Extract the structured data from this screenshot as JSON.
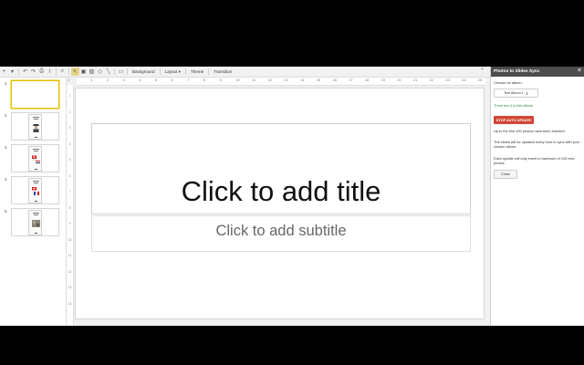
{
  "toolbar": {
    "buttons": [
      {
        "name": "new-slide-icon",
        "glyph": "+"
      },
      {
        "name": "dropdown-icon",
        "glyph": "▾"
      },
      {
        "name": "undo-icon",
        "glyph": "↶"
      },
      {
        "name": "redo-icon",
        "glyph": "↷"
      },
      {
        "name": "print-icon",
        "glyph": "⎙"
      },
      {
        "name": "paint-format-icon",
        "glyph": "⌇"
      },
      {
        "name": "zoom-icon",
        "glyph": "⌕"
      },
      {
        "name": "select-icon",
        "glyph": "↖"
      },
      {
        "name": "textbox-icon",
        "glyph": "▣"
      },
      {
        "name": "image-icon",
        "glyph": "▨"
      },
      {
        "name": "shape-icon",
        "glyph": "◇"
      },
      {
        "name": "line-icon",
        "glyph": "╲"
      },
      {
        "name": "comment-icon",
        "glyph": "▭"
      }
    ],
    "background_label": "Background",
    "layout_label": "Layout ▾",
    "theme_label": "Theme",
    "transition_label": "Transition",
    "collapse_glyph": "⌃"
  },
  "ruler": {
    "top_numbers": [
      "1",
      "1",
      "2",
      "3",
      "4",
      "5",
      "6",
      "7",
      "8",
      "9",
      "10",
      "11",
      "12",
      "13",
      "14",
      "15",
      "16",
      "17",
      "18",
      "19",
      "20",
      "21",
      "22",
      "23",
      "24",
      "25"
    ],
    "left_numbers": [
      "1",
      "2",
      "3",
      "4",
      "5",
      "6",
      "7",
      "8",
      "9",
      "10",
      "11",
      "12",
      "13",
      "14"
    ]
  },
  "slides": [
    {
      "number": "1",
      "type": "blank",
      "selected": true
    },
    {
      "number": "2",
      "type": "person",
      "selected": false
    },
    {
      "number": "3",
      "type": "flags-red",
      "selected": false
    },
    {
      "number": "4",
      "type": "flags-fr",
      "selected": false
    },
    {
      "number": "5",
      "type": "photo",
      "selected": false
    }
  ],
  "canvas": {
    "title_placeholder": "Click to add title",
    "subtitle_placeholder": "Click to add subtitle"
  },
  "sidebar": {
    "title": "Photos to Slides Sync",
    "close_glyph": "×",
    "choose_label": "Choose an album:",
    "album_value": "Test Album 1",
    "album_count": "There are 4 in this album",
    "stop_button": "STOP AUTO UPDATE",
    "info1": "Up to the first 100 photos have been inserted",
    "info2": "The slides will be updated every hour to sync with your chosen album.",
    "info3": "Each update will only insert a maximum of 100 new photos",
    "close_button": "Close"
  },
  "colors": {
    "accent_green": "#1e8e3e",
    "stop_red": "#d14836",
    "selected_border": "#e5c100",
    "sidebar_header": "#4d4d4d"
  }
}
